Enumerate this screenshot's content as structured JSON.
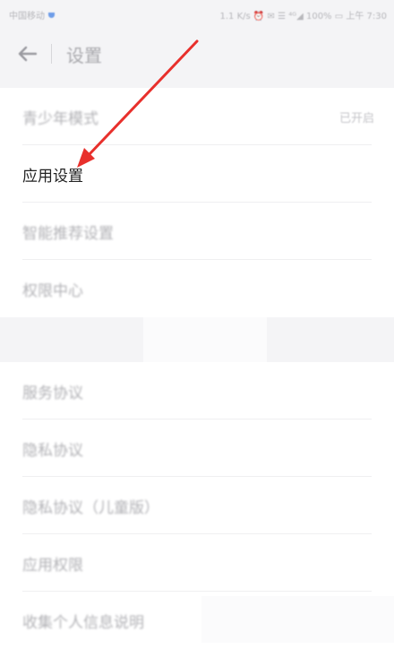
{
  "status_bar": {
    "carrier": "中国移动",
    "right_text": "1.1 K/s ⏰ ✉ ☰ ⁴ᴳ◢ 100% ▭ 上午 7:30"
  },
  "header": {
    "title": "设置",
    "back_icon": "arrow-left-icon"
  },
  "settings": {
    "items": [
      {
        "label": "青少年模式",
        "value": "已开启"
      },
      {
        "label": "应用设置"
      },
      {
        "label": "智能推荐设置"
      },
      {
        "label": "权限中心"
      }
    ],
    "items2": [
      {
        "label": "服务协议"
      },
      {
        "label": "隐私协议"
      },
      {
        "label": "隐私协议（儿童版）"
      },
      {
        "label": "应用权限"
      },
      {
        "label": "收集个人信息说明"
      }
    ]
  },
  "annotation": {
    "arrow_color": "#e8302c"
  }
}
